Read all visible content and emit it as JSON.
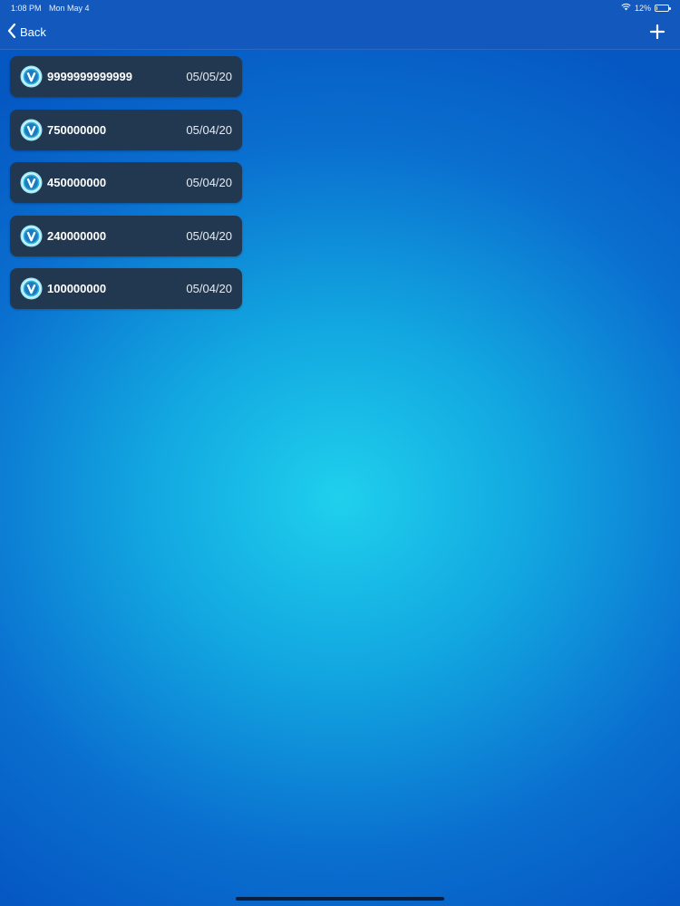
{
  "status_bar": {
    "time": "1:08 PM",
    "date": "Mon May 4",
    "battery": "12%",
    "battery_level": 0.12,
    "wifi_icon": "wifi-icon"
  },
  "nav": {
    "back_label": "Back",
    "add_icon": "plus-icon"
  },
  "items": [
    {
      "amount": "9999999999999",
      "date": "05/05/20",
      "icon": "vbucks-coin-icon"
    },
    {
      "amount": "750000000",
      "date": "05/04/20",
      "icon": "vbucks-coin-icon"
    },
    {
      "amount": "450000000",
      "date": "05/04/20",
      "icon": "vbucks-coin-icon"
    },
    {
      "amount": "240000000",
      "date": "05/04/20",
      "icon": "vbucks-coin-icon"
    },
    {
      "amount": "100000000",
      "date": "05/04/20",
      "icon": "vbucks-coin-icon"
    }
  ],
  "colors": {
    "nav_background": "#1258bd",
    "row_background": "#223750",
    "coin_accent": "#5fd8f0"
  }
}
